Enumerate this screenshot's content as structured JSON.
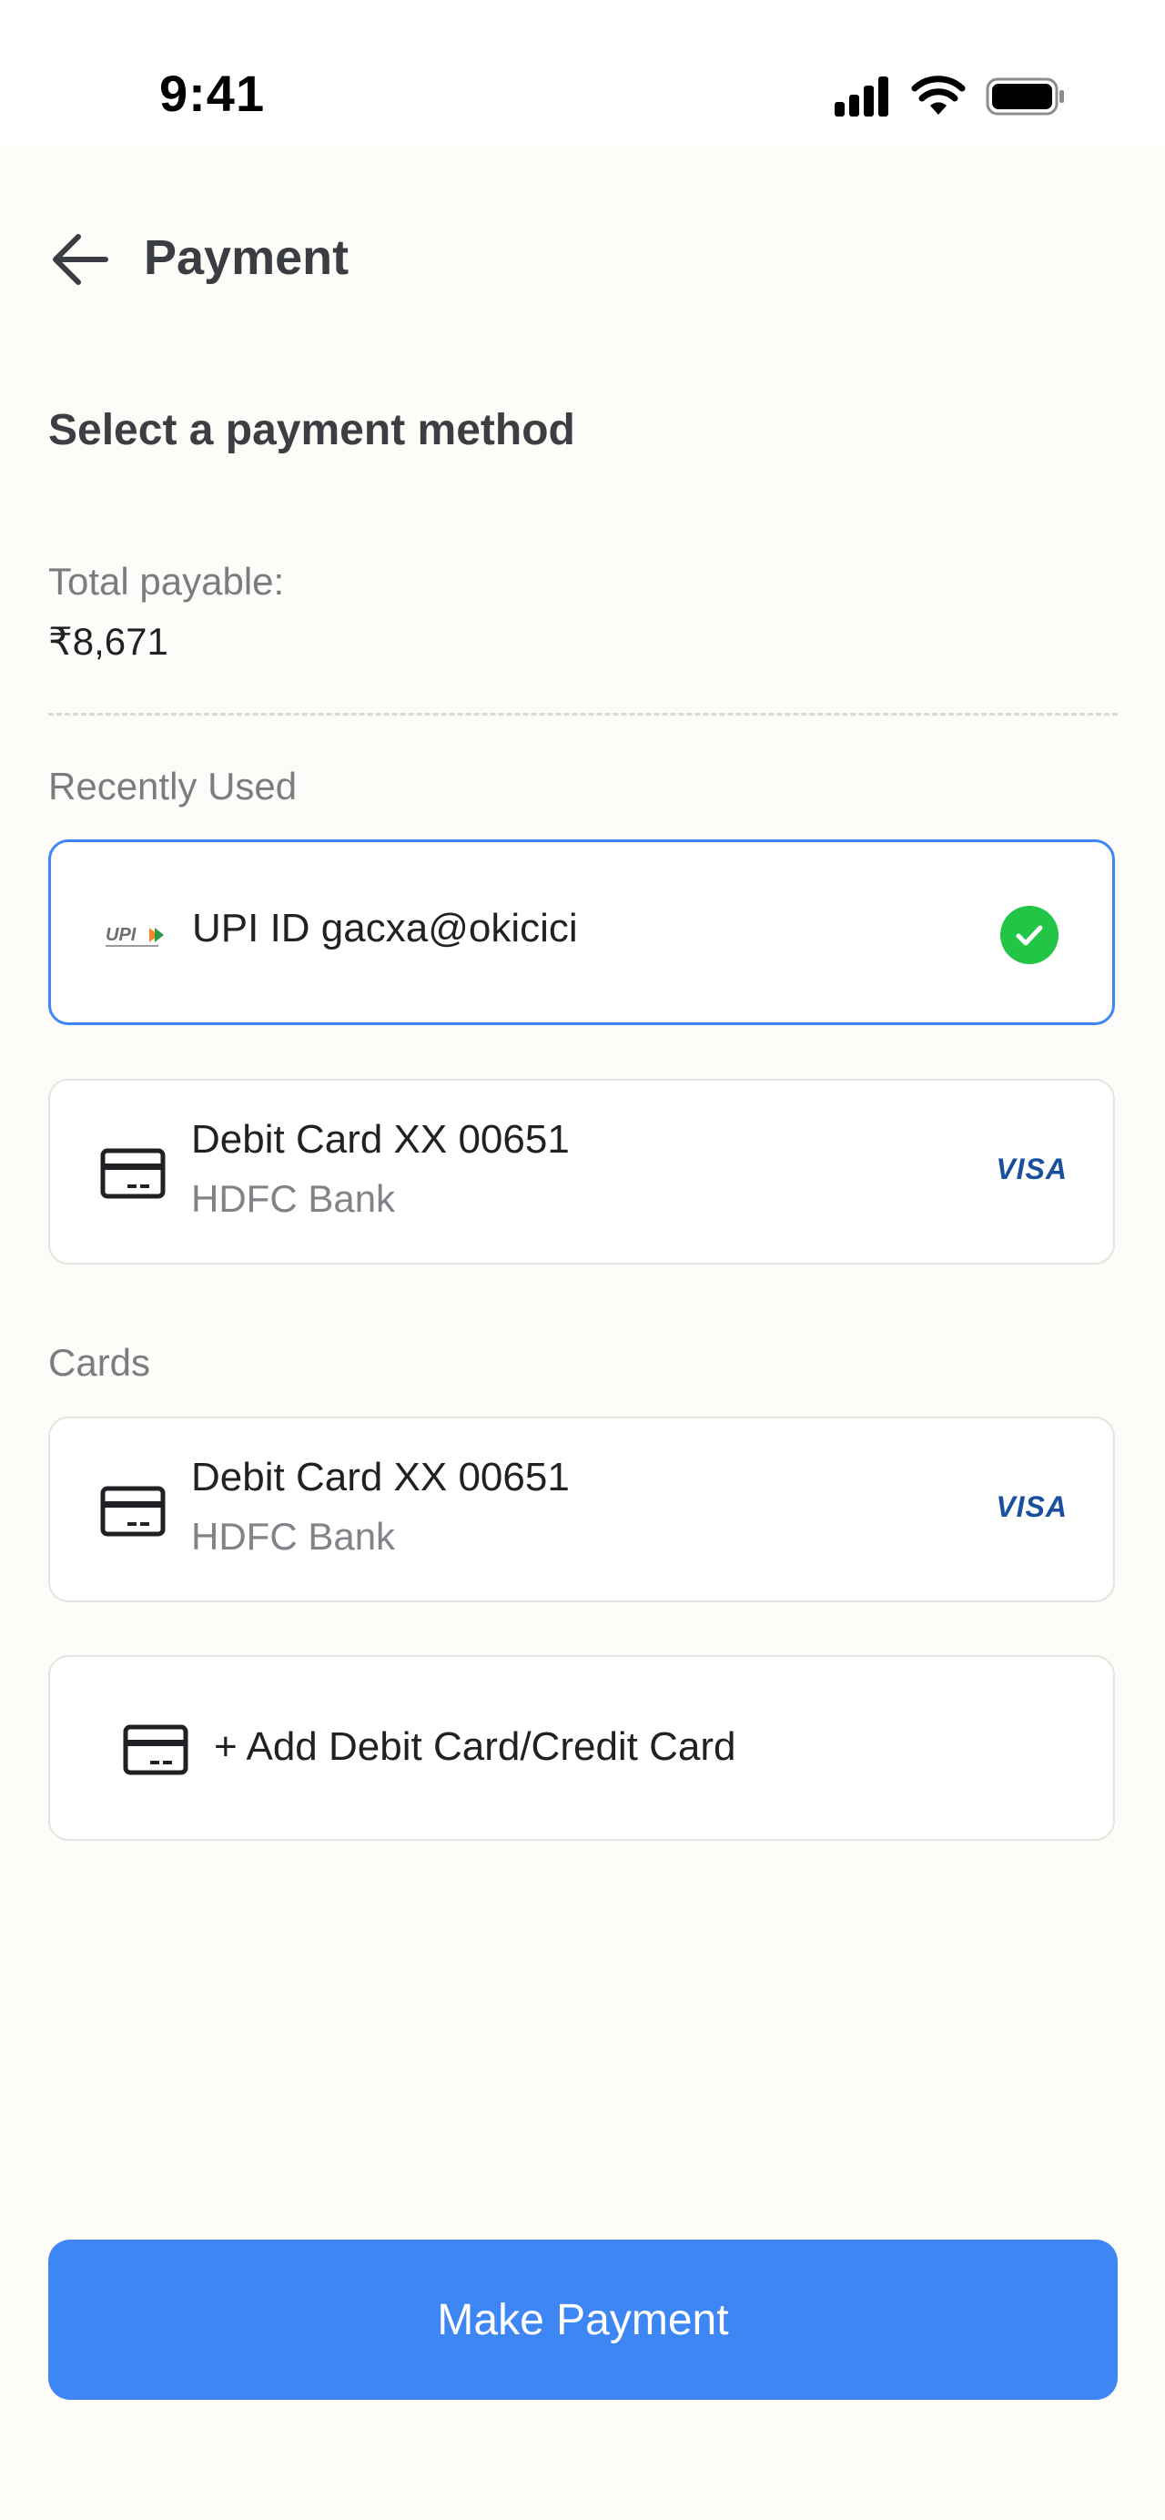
{
  "status_bar": {
    "time": "9:41",
    "icons": [
      "cellular-signal-icon",
      "wifi-icon",
      "battery-icon"
    ]
  },
  "header": {
    "back_icon": "arrow-left-icon",
    "title": "Payment"
  },
  "section_title": "Select a payment method",
  "total": {
    "label": "Total payable:",
    "value": "₹8,671"
  },
  "recently_used": {
    "label": "Recently Used",
    "items": [
      {
        "icon": "upi-logo-icon",
        "logo_text": "UPI",
        "title": "UPI ID gacxa@okicici",
        "selected": true,
        "status_icon": "check-circle-icon"
      },
      {
        "icon": "credit-card-icon",
        "title": "Debit Card XX 00651",
        "subtitle": "HDFC Bank",
        "network": "VISA"
      }
    ]
  },
  "cards": {
    "label": "Cards",
    "items": [
      {
        "icon": "credit-card-icon",
        "title": "Debit Card XX 00651",
        "subtitle": "HDFC Bank",
        "network": "VISA"
      }
    ],
    "add_label": "+ Add Debit Card/Credit Card"
  },
  "primary_action": {
    "label": "Make Payment"
  },
  "colors": {
    "accent": "#3f86f5",
    "success": "#22c545",
    "background": "#fdfcf8",
    "visa_blue": "#1a4fa0"
  }
}
